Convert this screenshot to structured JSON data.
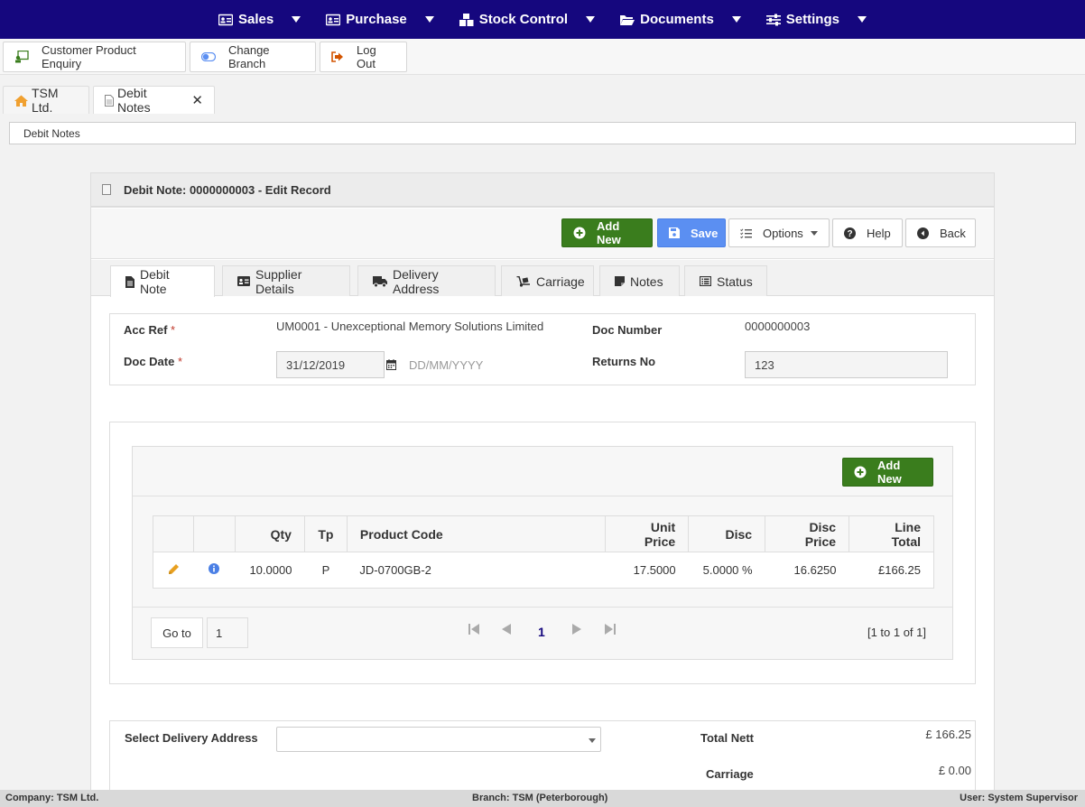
{
  "topnav": {
    "items": [
      {
        "label": "Sales",
        "icon": "id-card-icon"
      },
      {
        "label": "Purchase",
        "icon": "id-card-icon"
      },
      {
        "label": "Stock Control",
        "icon": "boxes-icon"
      },
      {
        "label": "Documents",
        "icon": "folder-open-icon"
      },
      {
        "label": "Settings",
        "icon": "sliders-icon"
      }
    ]
  },
  "actionbar": {
    "customer_enquiry": "Customer Product Enquiry",
    "change_branch": "Change Branch",
    "log_out": "Log Out"
  },
  "pagetabs": {
    "home": "TSM Ltd.",
    "debit_notes": "Debit Notes",
    "close": "✕"
  },
  "breadcrumb": "Debit Notes",
  "panel": {
    "title": "Debit Note: 0000000003 - Edit Record",
    "toolbar": {
      "add_new": "Add New",
      "save": "Save",
      "options": "Options",
      "help": "Help",
      "back": "Back"
    },
    "tabs": [
      {
        "label": "Debit Note"
      },
      {
        "label": "Supplier Details"
      },
      {
        "label": "Delivery Address"
      },
      {
        "label": "Carriage"
      },
      {
        "label": "Notes"
      },
      {
        "label": "Status"
      }
    ],
    "form": {
      "acc_ref_label": "Acc Ref",
      "acc_ref_value": "UM0001 - Unexceptional Memory Solutions Limited",
      "doc_number_label": "Doc Number",
      "doc_number_value": "0000000003",
      "doc_date_label": "Doc Date",
      "doc_date_value": "31/12/2019",
      "date_format": "DD/MM/YYYY",
      "returns_no_label": "Returns No",
      "returns_no_value": "123",
      "required": "*"
    },
    "grid": {
      "add_new": "Add New",
      "columns": [
        "",
        "",
        "Qty",
        "Tp",
        "Product Code",
        "Unit Price",
        "Disc",
        "Disc Price",
        "Line Total"
      ],
      "rows": [
        {
          "qty": "10.0000",
          "tp": "P",
          "product_code": "JD-0700GB-2",
          "unit_price": "17.5000",
          "disc": "5.0000 %",
          "disc_price": "16.6250",
          "line_total": "£166.25"
        }
      ],
      "pager": {
        "goto_label": "Go to",
        "goto_value": "1",
        "current_page": "1",
        "info": "[1 to 1 of 1]"
      }
    },
    "summary": {
      "delivery_label": "Select Delivery Address",
      "delivery_value": "",
      "total_nett_label": "Total Nett",
      "total_nett_value": "£ 166.25",
      "carriage_label": "Carriage",
      "carriage_value": "£ 0.00"
    }
  },
  "statusbar": {
    "company": "Company: TSM Ltd.",
    "branch": "Branch: TSM (Peterborough)",
    "user": "User: System Supervisor"
  },
  "colors": {
    "nav_bg": "#15077e",
    "green": "#3a7d1d",
    "blue": "#5b8ff2"
  }
}
